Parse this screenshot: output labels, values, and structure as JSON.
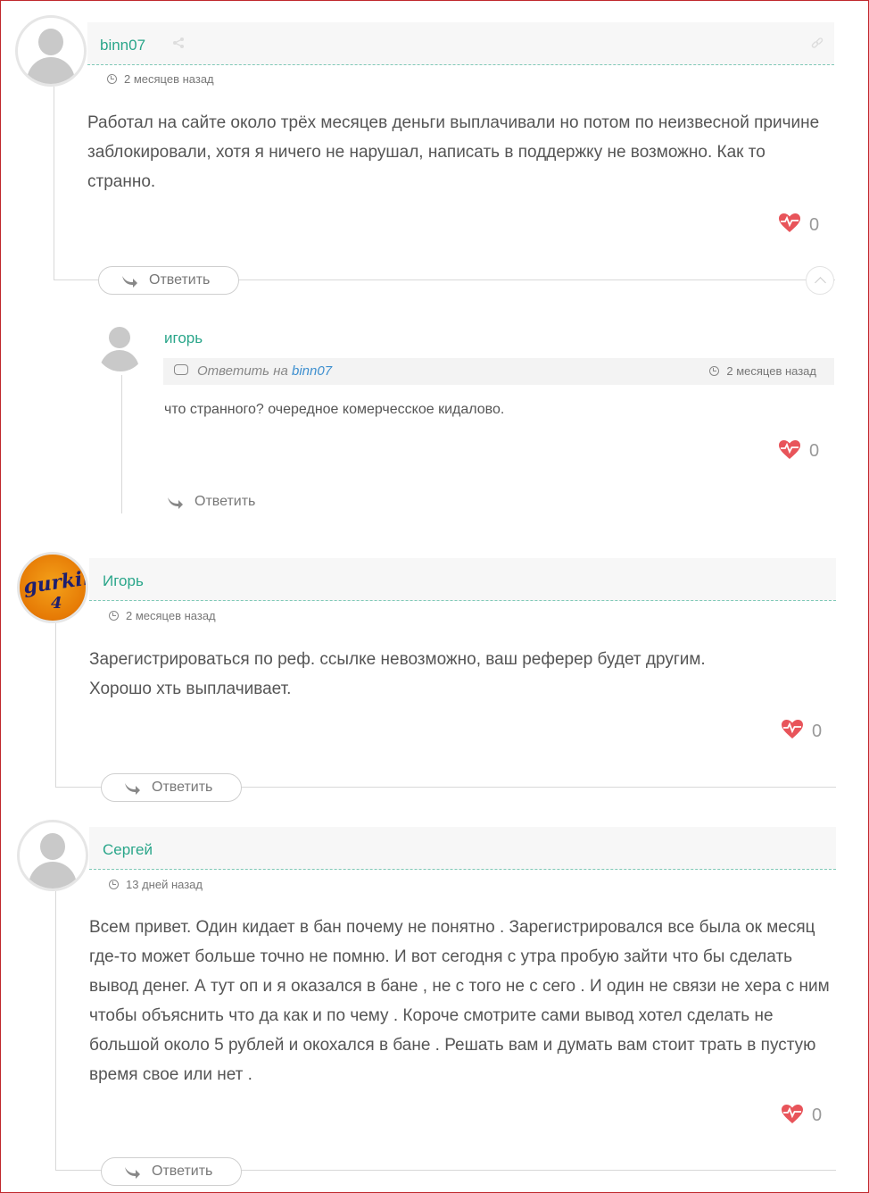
{
  "comments": [
    {
      "author": "binn07",
      "time": "2 месяцев назад",
      "text": "Работал на сайте около трёх месяцев деньги выплачивали но потом по неизвесной причине заблокировали, хотя я ничего не нарушал, написать в поддержку не возможно. Как то странно.",
      "likes": "0",
      "reply_label": "Ответить",
      "replies": [
        {
          "author": "игорь",
          "reply_to_prefix": "Ответить на",
          "reply_to_author": "binn07",
          "time": "2 месяцев назад",
          "text": "что странного? очередное комерчесское кидалово.",
          "likes": "0",
          "reply_label": "Ответить"
        }
      ]
    },
    {
      "author": "Игорь",
      "avatar_text": "gurkin",
      "avatar_subtext": "4",
      "time": "2 месяцев назад",
      "text": "Зарегистрироваться по реф. ссылке невозможно, ваш реферер будет другим. Хорошо хть выплачивает.",
      "likes": "0",
      "reply_label": "Ответить"
    },
    {
      "author": "Сергей",
      "time": "13 дней назад",
      "text": "Всем привет. Один кидает в бан почему не понятно . Зарегистрировался все была ок месяц где-то может больше точно не помню. И вот сегодня с утра пробую зайти что бы сделать вывод денег. А тут оп и я оказался в бане , не с того не с сего . И один не связи не хера с ним чтобы объяснить что да как и по чему . Короче смотрите сами вывод хотел сделать не большой около 5 рублей и окохался в бане . Решать вам и думать вам стоит трать в пустую время свое или нет .",
      "likes": "0",
      "reply_label": "Ответить"
    }
  ],
  "colors": {
    "author": "#2aa68a",
    "heart": "#e8545a",
    "link": "#3d8fcf",
    "frame": "#c0282d"
  },
  "icons": {
    "share": "share-icon",
    "link": "link-icon",
    "clock": "clock-icon",
    "heart": "heart-pulse-icon",
    "reply": "reply-arrow-icon",
    "collapse": "chevron-up-icon",
    "bubble": "comment-bubble-icon"
  }
}
